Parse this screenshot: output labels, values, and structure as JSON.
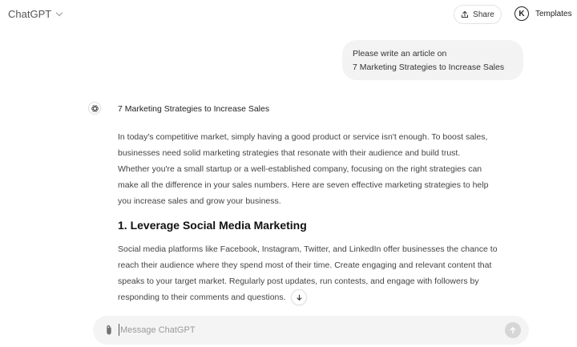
{
  "header": {
    "model_name": "ChatGPT",
    "share_label": "Share",
    "avatar_initial": "K",
    "templates_label": "Templates"
  },
  "user_message": {
    "lines": [
      "Please write an article on",
      "7 Marketing Strategies to Increase Sales"
    ]
  },
  "assistant": {
    "title": "7 Marketing Strategies to Increase Sales",
    "intro_lines": [
      "In today's competitive market, simply having a good product or service isn't enough. To boost sales,",
      "businesses need solid marketing strategies that resonate with their audience and build trust.",
      "Whether you're a small startup or a well-established company, focusing on the right strategies can",
      "make all the difference in your sales numbers. Here are seven effective marketing strategies to help",
      "you increase sales and grow your business."
    ],
    "heading_1": "1. Leverage Social Media Marketing",
    "section_1_lines": [
      "Social media platforms like Facebook, Instagram, Twitter, and LinkedIn offer businesses the chance to",
      "reach their audience where they spend most of their time. Create engaging and relevant content that",
      "speaks to your target market. Regularly post updates, run contests, and engage with followers by",
      "responding to their comments and questions."
    ]
  },
  "composer": {
    "placeholder": "Message ChatGPT",
    "value": ""
  },
  "icons": {
    "model_dropdown": "chevron-down-icon",
    "share": "share-icon",
    "assistant": "openai-logo-icon",
    "scroll_down": "arrow-down-icon",
    "attach": "paperclip-icon",
    "send": "arrow-up-icon"
  }
}
